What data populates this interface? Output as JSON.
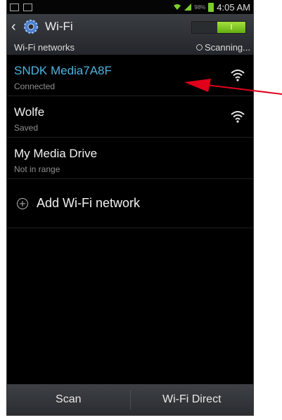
{
  "status_bar": {
    "battery_percent": "98%",
    "time": "4:05 AM"
  },
  "header": {
    "title": "Wi-Fi",
    "toggle_label": "I"
  },
  "subheader": {
    "title": "Wi-Fi networks",
    "scan_status": "Scanning..."
  },
  "networks": [
    {
      "name": "SNDK Media7A8F",
      "status": "Connected",
      "connected": true,
      "signal_icon": "wifi-icon"
    },
    {
      "name": "Wolfe",
      "status": "Saved",
      "connected": false,
      "signal_icon": "wifi-icon"
    },
    {
      "name": "My Media Drive",
      "status": "Not in range",
      "connected": false,
      "signal_icon": null
    }
  ],
  "add_network": {
    "label": "Add Wi-Fi network"
  },
  "bottom_bar": {
    "scan_label": "Scan",
    "wifi_direct_label": "Wi-Fi Direct"
  },
  "colors": {
    "connected": "#4fb4df",
    "toggle_on": "#7ccf2a",
    "annotation_arrow": "#e0001b"
  }
}
